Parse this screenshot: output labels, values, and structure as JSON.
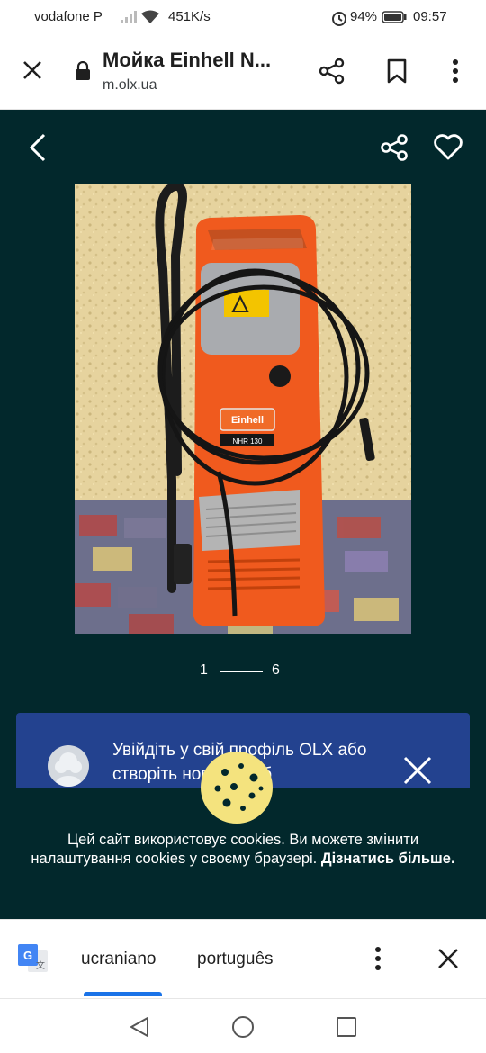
{
  "status_bar": {
    "carrier": "vodafone P",
    "network_speed": "451K/s",
    "battery_percent": "94%",
    "time": "09:57",
    "icons": [
      "signal-icon",
      "wifi-icon",
      "alarm-icon",
      "battery-icon"
    ]
  },
  "browser": {
    "page_title": "Мойка Einhell N...",
    "url": "m.olx.ua",
    "icons": [
      "close-icon",
      "lock-icon",
      "share-icon",
      "bookmark-icon",
      "more-vert-icon"
    ]
  },
  "gallery": {
    "current_index": "1",
    "total_count": "6",
    "product_labels": {
      "brand": "Einhell",
      "model": "NHR 130"
    },
    "icons": [
      "back-arrow-icon",
      "share-icon",
      "heart-icon"
    ]
  },
  "login_banner": {
    "text": "Увійдіть у свій профіль OLX або створіть новий, щоб",
    "icons": [
      "user-avatar-icon",
      "close-icon"
    ]
  },
  "cookie_notice": {
    "text": "Цей сайт використовує cookies. Ви можете змінити налаштування cookies у своєму браузері. ",
    "link_text": "Дізнатись більше.",
    "icons": [
      "cookie-icon"
    ]
  },
  "translate_bar": {
    "source_language": "ucraniano",
    "target_language": "português",
    "icons": [
      "google-translate-icon",
      "more-vert-icon",
      "close-icon"
    ]
  },
  "nav_bar": {
    "icons": [
      "nav-back-icon",
      "nav-home-icon",
      "nav-recent-icon"
    ]
  },
  "colors": {
    "gallery_bg": "#02282c",
    "banner_bg": "#23428f",
    "accent_blue": "#1a73e8",
    "product_orange": "#f05a1e"
  }
}
